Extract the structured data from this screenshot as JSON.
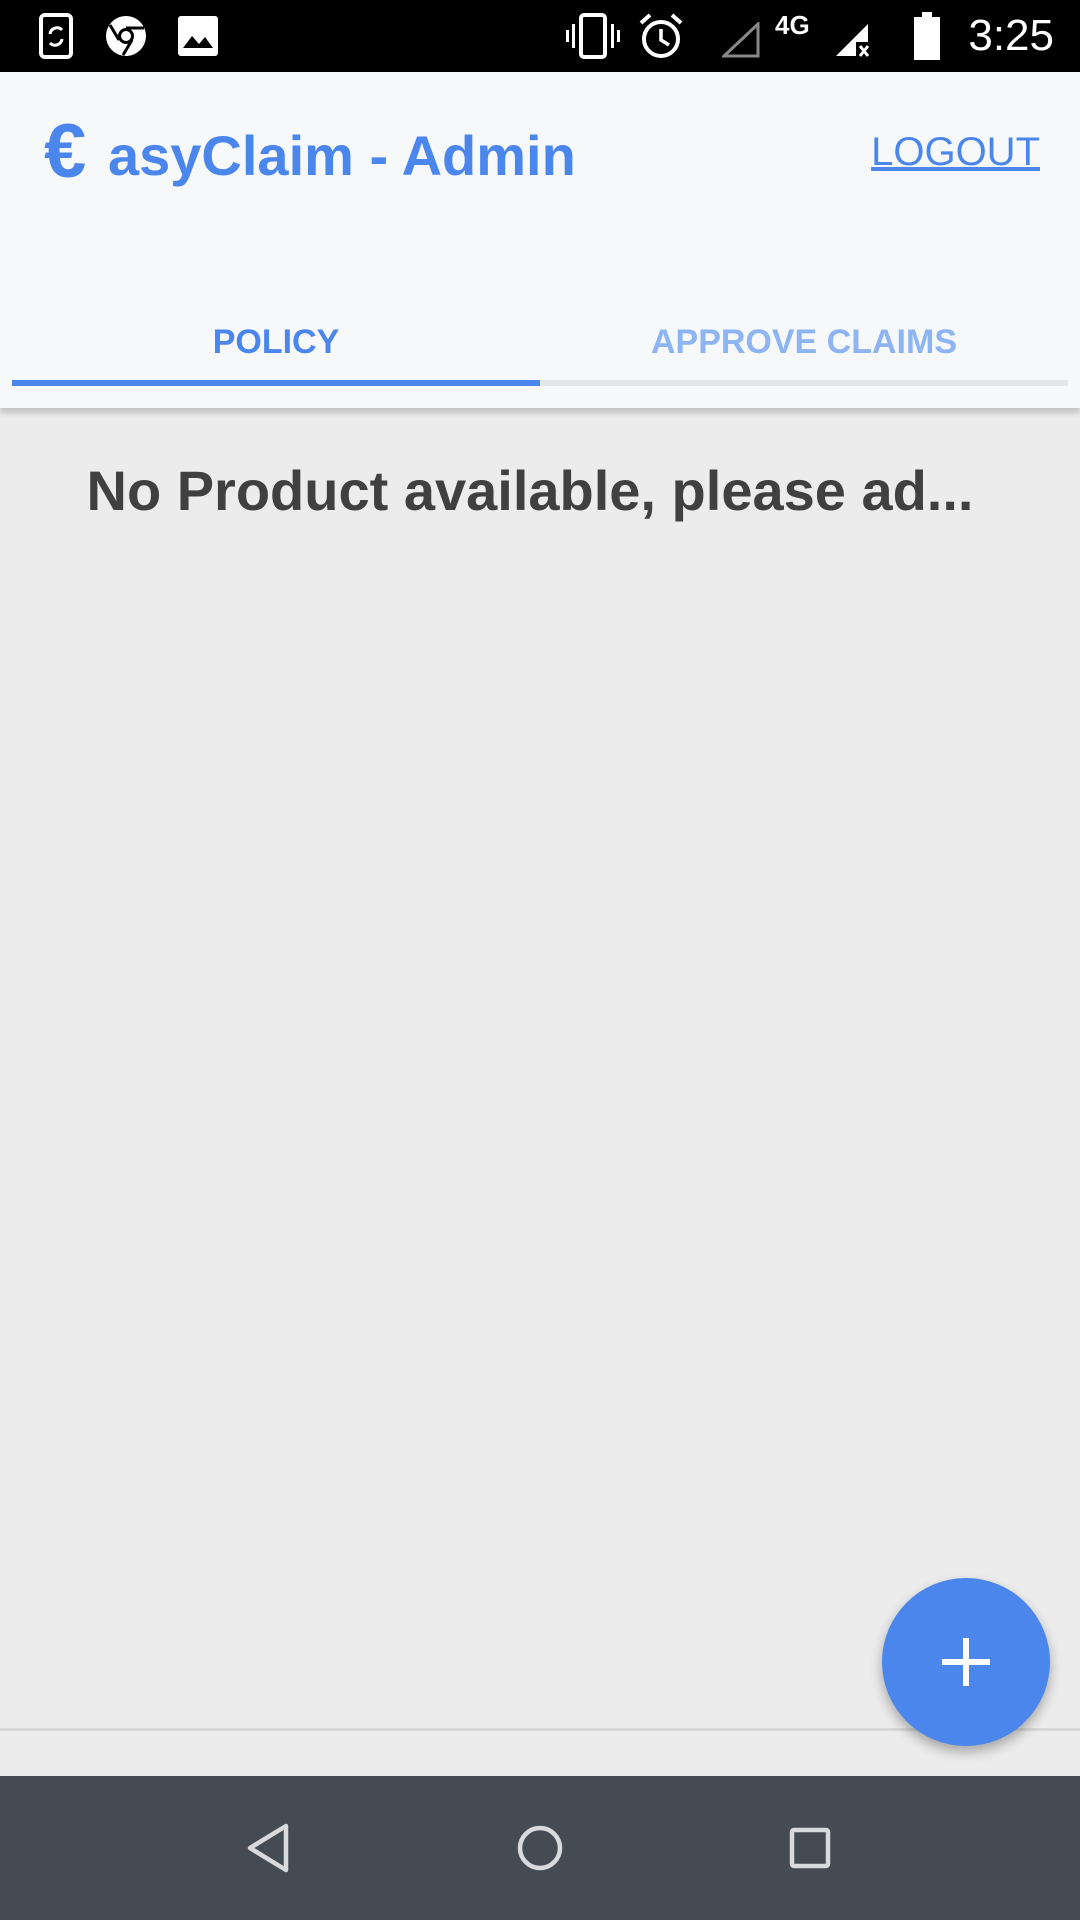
{
  "status_bar": {
    "time": "3:25",
    "network_label": "4G",
    "icons": [
      "phone-sync-icon",
      "chrome-icon",
      "image-icon",
      "vibrate-icon",
      "alarm-icon",
      "signal-empty-icon",
      "signal-no-data-icon",
      "battery-icon"
    ]
  },
  "header": {
    "brand_symbol": "€",
    "title": "asyClaim - Admin",
    "logout_label": "LOGOUT"
  },
  "tabs": [
    {
      "label": "POLICY",
      "active": true
    },
    {
      "label": "APPROVE CLAIMS",
      "active": false
    }
  ],
  "main": {
    "empty_message": "No Product available, please ad..."
  },
  "fab": {
    "icon": "plus-icon"
  },
  "nav_bar": {
    "icons": [
      "back-icon",
      "home-icon",
      "recents-icon"
    ]
  },
  "colors": {
    "accent": "#4a86ec",
    "accent_light": "#8db4f3",
    "header_bg": "#f7f8f9",
    "content_bg": "#ececed",
    "nav_bg": "#454b52"
  }
}
